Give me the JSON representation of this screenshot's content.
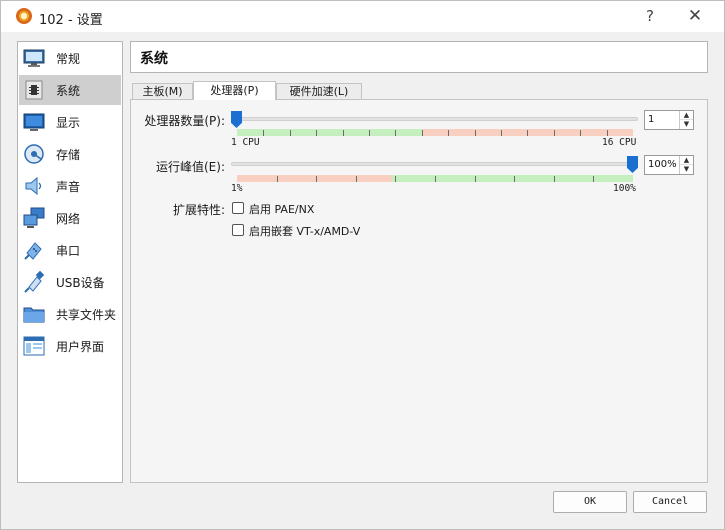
{
  "window": {
    "title": "102 - 设置",
    "help_glyph": "?",
    "close_glyph": "✕"
  },
  "sidebar": {
    "items": [
      {
        "label": "常规",
        "icon": "monitor-general-icon",
        "selected": false
      },
      {
        "label": "系统",
        "icon": "chip-system-icon",
        "selected": true
      },
      {
        "label": "显示",
        "icon": "display-icon",
        "selected": false
      },
      {
        "label": "存储",
        "icon": "storage-disk-icon",
        "selected": false
      },
      {
        "label": "声音",
        "icon": "speaker-icon",
        "selected": false
      },
      {
        "label": "网络",
        "icon": "network-icon",
        "selected": false
      },
      {
        "label": "串口",
        "icon": "serial-port-icon",
        "selected": false
      },
      {
        "label": "USB设备",
        "icon": "usb-icon",
        "selected": false
      },
      {
        "label": "共享文件夹",
        "icon": "shared-folder-icon",
        "selected": false
      },
      {
        "label": "用户界面",
        "icon": "user-interface-icon",
        "selected": false
      }
    ]
  },
  "header": {
    "title": "系统"
  },
  "tabs": [
    {
      "label": "主板(M)",
      "active": false
    },
    {
      "label": "处理器(P)",
      "active": true
    },
    {
      "label": "硬件加速(L)",
      "active": false
    }
  ],
  "processor": {
    "cpu_count_label": "处理器数量(P):",
    "cpu_count_value": "1",
    "cpu_min_label": "1 CPU",
    "cpu_max_label": "16 CPU",
    "cpu_count_min": 1,
    "cpu_count_max": 16,
    "cpu_count_current": 1,
    "exec_cap_label": "运行峰值(E):",
    "exec_cap_value": "100%",
    "exec_cap_min_label": "1%",
    "exec_cap_max_label": "100%",
    "exec_cap_current": 100,
    "extended_label": "扩展特性:",
    "pae_label": "启用 PAE/NX",
    "pae_checked": false,
    "nested_label": "启用嵌套 VT-x/AMD-V",
    "nested_checked": false
  },
  "footer": {
    "ok_label": "OK",
    "cancel_label": "Cancel"
  },
  "colors": {
    "accent": "#1a6fd1",
    "scale_green": "#c6efc0",
    "scale_red": "#f8cfc0",
    "selected_bg": "#cfcfcf"
  }
}
